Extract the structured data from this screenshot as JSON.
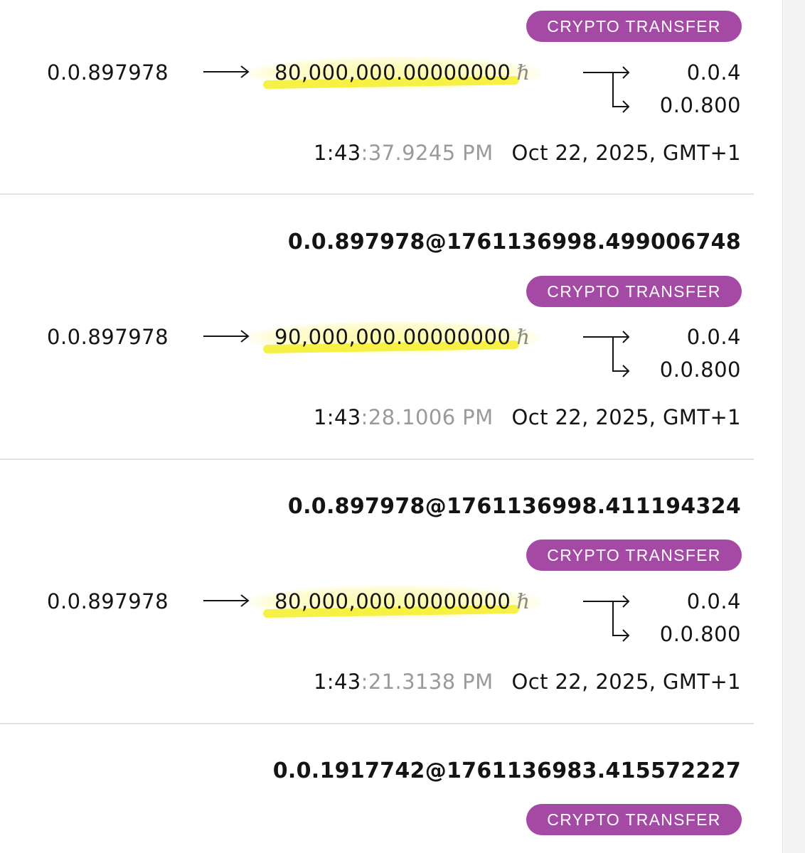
{
  "transactions": [
    {
      "badge": "CRYPTO TRANSFER",
      "sender": "0.0.897978",
      "amount": "80,000,000.00000000",
      "currency_symbol": "ℏ",
      "receivers": [
        "0.0.4",
        "0.0.800"
      ],
      "time_hm": "1:43",
      "time_rest": ":37.9245 PM",
      "date": "Oct 22, 2025, GMT+1"
    },
    {
      "tx_id": "0.0.897978@1761136998.499006748",
      "badge": "CRYPTO TRANSFER",
      "sender": "0.0.897978",
      "amount": "90,000,000.00000000",
      "currency_symbol": "ℏ",
      "receivers": [
        "0.0.4",
        "0.0.800"
      ],
      "time_hm": "1:43",
      "time_rest": ":28.1006 PM",
      "date": "Oct 22, 2025, GMT+1"
    },
    {
      "tx_id": "0.0.897978@1761136998.411194324",
      "badge": "CRYPTO TRANSFER",
      "sender": "0.0.897978",
      "amount": "80,000,000.00000000",
      "currency_symbol": "ℏ",
      "receivers": [
        "0.0.4",
        "0.0.800"
      ],
      "time_hm": "1:43",
      "time_rest": ":21.3138 PM",
      "date": "Oct 22, 2025, GMT+1"
    },
    {
      "tx_id": "0.0.1917742@1761136983.415572227",
      "badge": "CRYPTO TRANSFER"
    }
  ],
  "colors": {
    "badge_bg": "#a44aa5",
    "highlight": "#f5f03c",
    "muted_time": "#9a9a9a"
  }
}
